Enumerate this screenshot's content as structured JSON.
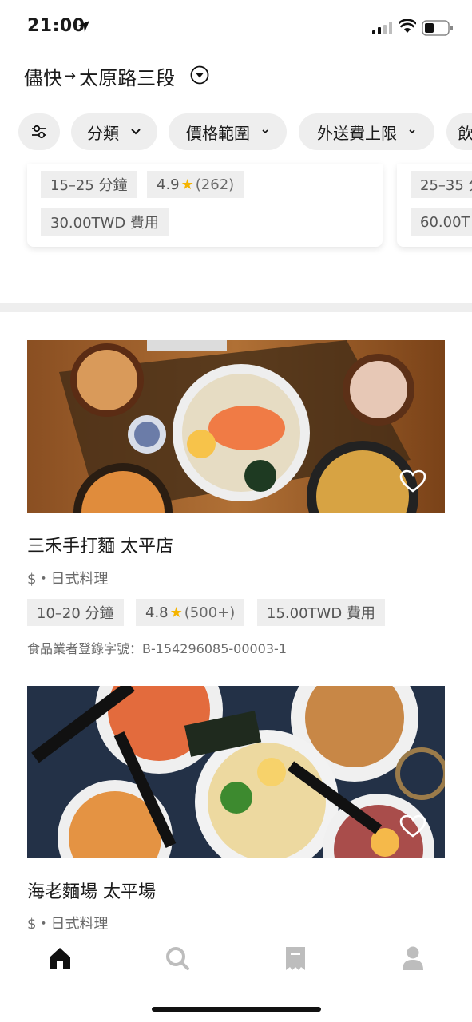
{
  "status_bar": {
    "time": "21:00"
  },
  "header": {
    "origin": "儘快",
    "arrow": "→",
    "destination": "太原路三段"
  },
  "filters": {
    "category": "分類",
    "price_range": "價格範圍",
    "delivery_fee_cap": "外送費上限",
    "more_partial": "飲"
  },
  "top_cards": [
    {
      "time": "15–25 分鐘",
      "rating": "4.9",
      "reviews": "(262)",
      "fee": "30.00TWD 費用"
    },
    {
      "time": "25–35 分",
      "fee": "60.00T"
    }
  ],
  "restaurants": [
    {
      "name": "三禾手打麵 太平店",
      "category": "$・日式料理",
      "time": "10–20 分鐘",
      "rating": "4.8",
      "reviews": "(500+)",
      "fee": "15.00TWD 費用",
      "registration": "食品業者登錄字號：B-154296085-00003-1"
    },
    {
      "name": "海老麵場 太平場",
      "category": "$・日式料理"
    }
  ],
  "bottom_nav": [
    "home-icon",
    "search-icon",
    "orders-icon",
    "account-icon"
  ],
  "colors": {
    "star": "#f5b400",
    "chip_bg": "#eeeeee",
    "text": "#1a1a1a"
  }
}
